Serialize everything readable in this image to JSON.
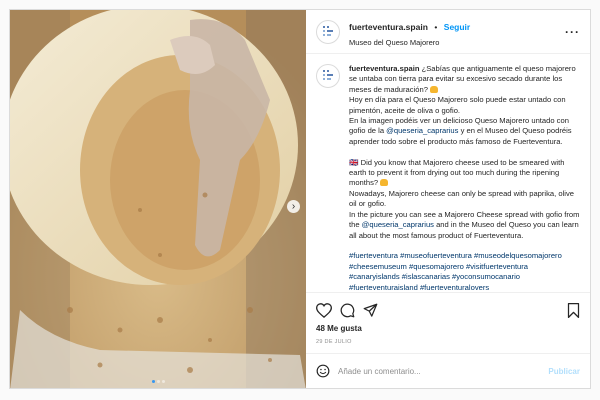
{
  "photo": {
    "alt": "Majorero cheese spread with gofio",
    "dots": 3,
    "active_dot": 1
  },
  "header": {
    "username": "fuerteventura.spain",
    "separator": "•",
    "follow_label": "Seguir",
    "location": "Museo del Queso Majorero",
    "more_icon": "more-horizontal-icon"
  },
  "caption": {
    "username": "fuerteventura.spain",
    "es_part1": " ¿Sabías que antiguamente el queso majorero se untaba con tierra para evitar su excesivo secado durante los meses de maduración? ",
    "es_part2": "Hoy en día para el Queso Majorero solo puede estar untado con pimentón, aceite de oliva o gofio.",
    "es_part3": "En la imagen podéis ver un delicioso Queso Majorero untado con gofio de la ",
    "es_mention": "@queseria_caprarius",
    "es_part4": " y en el Museo del Queso podréis aprender todo sobre el producto más famoso de Fuerteventura.",
    "flag": "🇬🇧",
    "en_part1": " Did you know that Majorero cheese used to be smeared with earth to prevent it from drying out too much during the ripening months? ",
    "en_part2": "Nowadays, Majorero cheese can only be spread with paprika, olive oil or gofio.",
    "en_part3": "In the picture you can see a Majorero Cheese spread with gofio from the ",
    "en_mention": "@queseria_caprarius",
    "en_part4": " and in the Museo del Queso you can learn all about the most famous product of Fuerteventura.",
    "hashtags": [
      "#fuerteventura",
      "#museofuerteventura",
      "#museodelquesomajorero",
      "#cheesemuseum",
      "#quesomajorero",
      "#visitfuerteventura",
      "#canaryislands",
      "#islascanarias",
      "#yoconsumocanario",
      "#fuerteventuraisland",
      "#fuerteventuralovers"
    ]
  },
  "actions": {
    "likes": "48 Me gusta",
    "date": "29 DE JULIO",
    "icons": [
      "heart-icon",
      "comment-icon",
      "share-icon",
      "bookmark-icon"
    ]
  },
  "comment": {
    "placeholder": "Añade un comentario...",
    "publish_label": "Publicar"
  },
  "colors": {
    "accent": "#0095f6",
    "link": "#00376b",
    "muted": "#8e8e8e",
    "publish_disabled": "#b2dffc"
  }
}
